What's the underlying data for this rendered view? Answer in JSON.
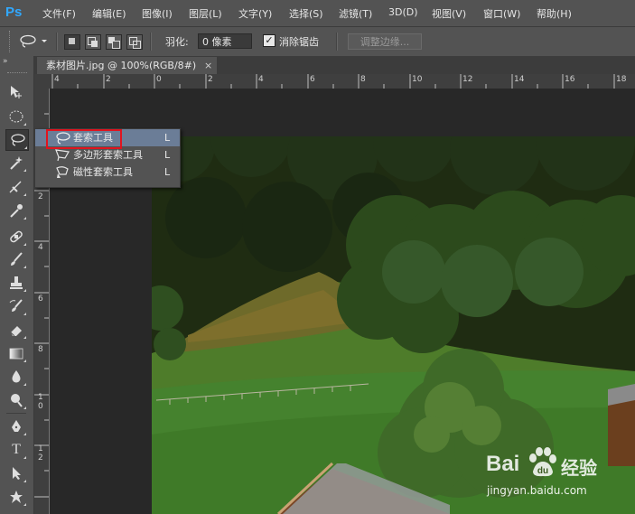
{
  "app": {
    "logo": "Ps"
  },
  "menubar": {
    "items": [
      "文件(F)",
      "编辑(E)",
      "图像(I)",
      "图层(L)",
      "文字(Y)",
      "选择(S)",
      "滤镜(T)",
      "3D(D)",
      "视图(V)",
      "窗口(W)",
      "帮助(H)"
    ]
  },
  "options": {
    "feather_label": "羽化:",
    "feather_value": "0 像素",
    "antialias_label": "消除锯齿",
    "antialias_checked": true,
    "refine_label": "调整边缘..."
  },
  "document": {
    "tab_title": "素材图片.jpg @ 100%(RGB/8#)",
    "close": "×"
  },
  "rulers": {
    "h_labels": [
      "4",
      "2",
      "0",
      "2",
      "4",
      "6",
      "8",
      "10",
      "12",
      "14",
      "16",
      "18"
    ],
    "v_labels": [
      "2",
      "4",
      "6",
      "8",
      "1 0",
      "1 2"
    ]
  },
  "flyout": {
    "items": [
      {
        "label": "套索工具",
        "key": "L",
        "selected": true
      },
      {
        "label": "多边形套索工具",
        "key": "L",
        "selected": false
      },
      {
        "label": "磁性套索工具",
        "key": "L",
        "selected": false
      }
    ]
  },
  "toolpanel": {
    "collapse": "»"
  },
  "tools": {
    "type_tool": "T"
  },
  "watermark": {
    "brand_left": "Bai",
    "brand_right": "经验",
    "url": "jingyan.baidu.com"
  },
  "colors": {
    "selection": "#6b7d97",
    "highlight_box": "#e0141f",
    "panel": "#535353"
  }
}
